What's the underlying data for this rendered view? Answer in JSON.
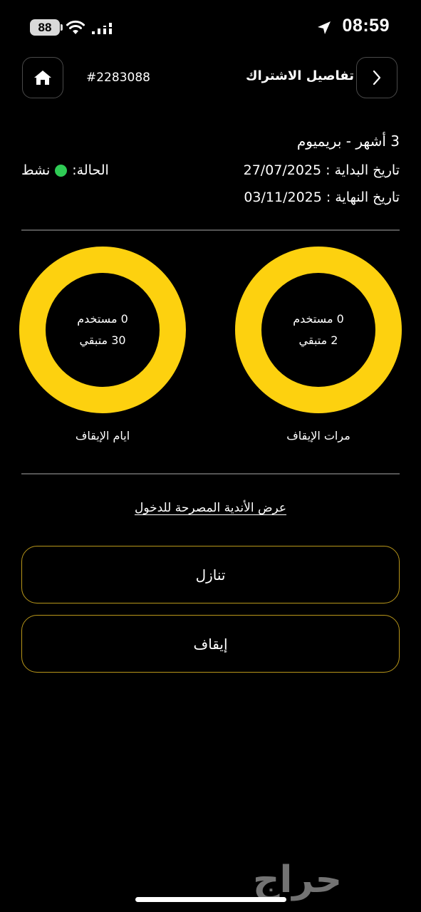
{
  "status_bar": {
    "time": "08:59",
    "battery": "88",
    "icons": [
      "location-arrow-icon",
      "wifi-icon",
      "cellular-signal-icon"
    ]
  },
  "header": {
    "title": "تفاصيل الاشتراك",
    "order_id": "#2283088",
    "icons": [
      "home-icon",
      "chevron-right-icon"
    ]
  },
  "subscription": {
    "plan": "3 أشهر - بريميوم",
    "start_date": "تاريخ البداية : 27/07/2025",
    "end_date": "تاريخ النهاية : 03/11/2025",
    "status_label": "الحالة:",
    "status_value": "نشط",
    "status_color": "#2fcb55"
  },
  "stats": {
    "pause_times": {
      "used": "0 مستخدم",
      "remaining": "2 متبقي",
      "label": "مرات الإيقاف"
    },
    "pause_days": {
      "used": "0 مستخدم",
      "remaining": "30 متبقي",
      "label": "ايام الإيقاف"
    },
    "ring_color": "#fdd10f"
  },
  "link_text": "عرض الأندية المصرحة للدخول",
  "buttons": {
    "withdraw": "تنازل",
    "pause": "إيقاف"
  },
  "watermark": "حراج"
}
